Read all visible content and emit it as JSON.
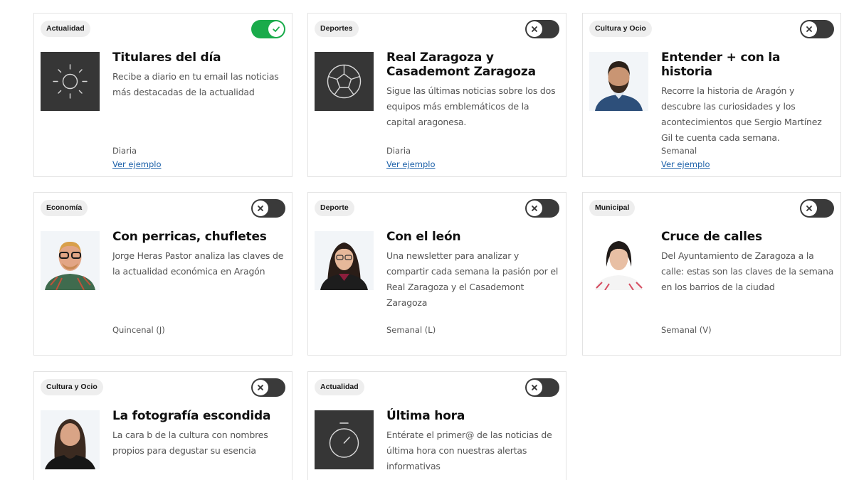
{
  "cards": [
    {
      "tag": "Actualidad",
      "enabled": true,
      "icon": "sun-icon",
      "title": "Titulares del día",
      "description": "Recibe a diario en tu email las noticias más destacadas de la actualidad",
      "frequency": "Diaria",
      "example_link": "Ver ejemplo"
    },
    {
      "tag": "Deportes",
      "enabled": false,
      "icon": "soccer-ball-icon",
      "title": "Real Zaragoza y Casademont Zaragoza",
      "description": "Sigue las últimas noticias sobre los dos equipos más emblemáticos de la capital aragonesa.",
      "frequency": "Diaria",
      "example_link": "Ver ejemplo"
    },
    {
      "tag": "Cultura y Ocio",
      "enabled": false,
      "icon": "author-photo",
      "title": "Entender + con la historia",
      "description": "Recorre la historia de Aragón y descubre las curiosidades y los acontecimientos que Sergio Martínez Gil te cuenta cada semana.",
      "frequency": "Semanal",
      "example_link": "Ver ejemplo"
    },
    {
      "tag": "Economía",
      "enabled": false,
      "icon": "author-photo",
      "title": "Con perricas, chufletes",
      "description": "Jorge Heras Pastor analiza las claves de la actualidad económica en Aragón",
      "frequency": "Quincenal (J)"
    },
    {
      "tag": "Deporte",
      "enabled": false,
      "icon": "author-photo",
      "title": "Con el león",
      "description": "Una newsletter para analizar y compartir cada semana la pasión por el Real Zaragoza y el Casademont Zaragoza",
      "frequency": "Semanal (L)"
    },
    {
      "tag": "Municipal",
      "enabled": false,
      "icon": "author-photo",
      "title": "Cruce de calles",
      "description": "Del Ayuntamiento de Zaragoza a la calle: estas son las claves de la semana en los barrios de la ciudad",
      "frequency": "Semanal (V)"
    },
    {
      "tag": "Cultura y Ocio",
      "enabled": false,
      "icon": "author-photo",
      "title": "La fotografía escondida",
      "description": "La cara b de la cultura con nombres propios para degustar su esencia"
    },
    {
      "tag": "Actualidad",
      "enabled": false,
      "icon": "stopwatch-icon",
      "title": "Última hora",
      "description": "Entérate el primer@ de las noticias de última hora con nuestras alertas informativas"
    }
  ],
  "colors": {
    "toggle_on": "#1aab4b",
    "toggle_off": "#3a3a3a",
    "link": "#1a5fa8"
  }
}
